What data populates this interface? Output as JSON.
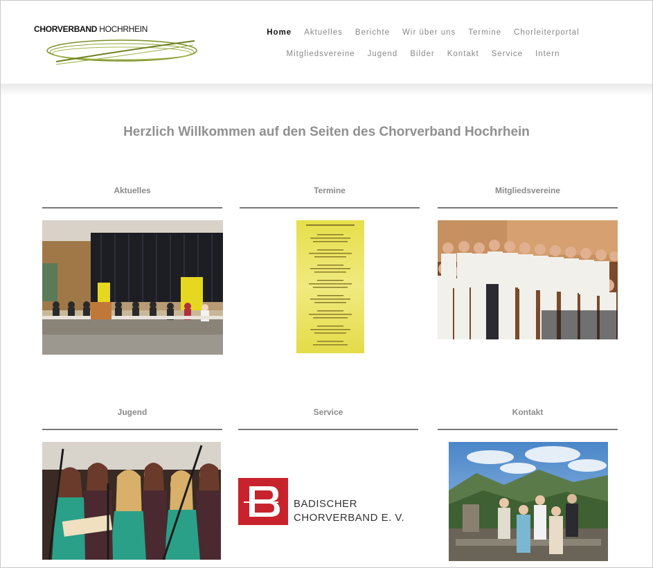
{
  "header": {
    "logo_bold": "CHORVERBAND",
    "logo_light": "HOCHRHEIN",
    "nav_row1": [
      "Home",
      "Aktuelles",
      "Berichte",
      "Wir über uns",
      "Termine",
      "Chorleiterportal"
    ],
    "nav_row2": [
      "Mitgliedsvereine",
      "Jugend",
      "Bilder",
      "Kontakt",
      "Service",
      "Intern"
    ],
    "active": "Home"
  },
  "main": {
    "welcome": "Herzlich Willkommen auf den Seiten des Chorverband Hochrhein",
    "sections": [
      {
        "title": "Aktuelles"
      },
      {
        "title": "Termine"
      },
      {
        "title": "Mitgliedsvereine"
      },
      {
        "title": "Jugend"
      },
      {
        "title": "Service"
      },
      {
        "title": "Kontakt"
      }
    ],
    "badischer": {
      "line1": "BADISCHER",
      "line2": "CHORVERBAND E. V."
    }
  },
  "colors": {
    "accent_green": "#7c8f2a",
    "badischer_red": "#c8232c",
    "flyer_yellow": "#e8e05a"
  }
}
